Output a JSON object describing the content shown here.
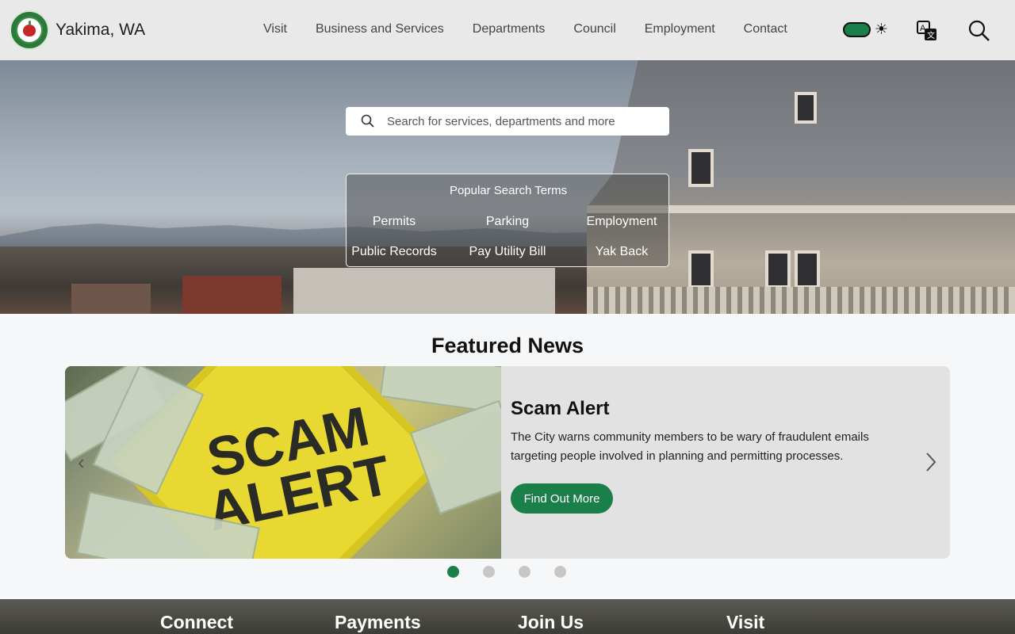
{
  "header": {
    "site_name": "Yakima, WA",
    "nav": [
      "Visit",
      "Business and Services",
      "Departments",
      "Council",
      "Employment",
      "Contact"
    ]
  },
  "hero": {
    "search_placeholder": "Search for services, departments and more",
    "popular_title": "Popular Search Terms",
    "popular_terms": [
      "Permits",
      "Parking",
      "Employment",
      "Public Records",
      "Pay Utility Bill",
      "Yak Back"
    ]
  },
  "featured": {
    "title": "Featured News",
    "card": {
      "image_text": "SCAM ALERT",
      "headline": "Scam Alert",
      "text": "The City warns community members to be wary of fraudulent emails targeting people involved in planning and permitting processes.",
      "button": "Find Out More"
    },
    "active_slide": 1,
    "slide_count": 4
  },
  "footer": {
    "headings": [
      "Connect",
      "Payments",
      "Join Us",
      "Visit"
    ]
  },
  "colors": {
    "accent": "#1b7f4a",
    "header_bg": "#e9e9e9"
  }
}
